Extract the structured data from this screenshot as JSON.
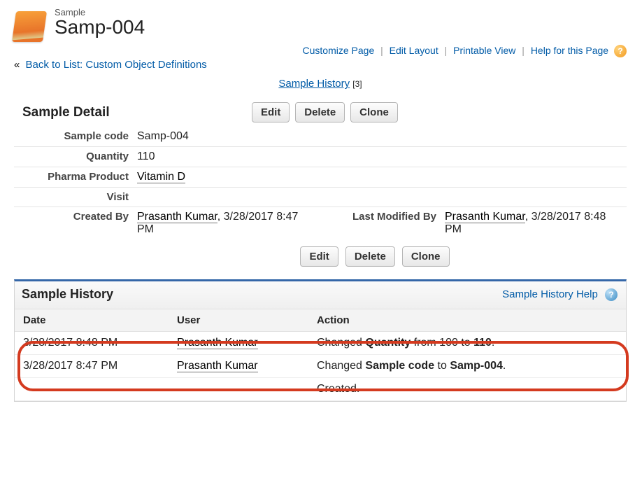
{
  "header": {
    "objectLabel": "Sample",
    "recordName": "Samp-004"
  },
  "actionLinks": {
    "customizePage": "Customize Page",
    "editLayout": "Edit Layout",
    "printableView": "Printable View",
    "helpForPage": "Help for this Page"
  },
  "backLink": {
    "prefix": "«",
    "text": "Back to List: Custom Object Definitions"
  },
  "miniList": {
    "label": "Sample History",
    "count": "[3]"
  },
  "detail": {
    "title": "Sample Detail",
    "buttons": {
      "edit": "Edit",
      "delete": "Delete",
      "clone": "Clone"
    },
    "labels": {
      "sampleCode": "Sample code",
      "quantity": "Quantity",
      "pharmaProduct": "Pharma Product",
      "visit": "Visit",
      "createdBy": "Created By",
      "lastModifiedBy": "Last Modified By"
    },
    "values": {
      "sampleCode": "Samp-004",
      "quantity": "110",
      "pharmaProduct": "Vitamin D",
      "visit": "",
      "createdByUser": "Prasanth Kumar",
      "createdByDate": ", 3/28/2017 8:47 PM",
      "lastModifiedByUser": "Prasanth Kumar",
      "lastModifiedByDate": ", 3/28/2017 8:48 PM"
    }
  },
  "history": {
    "title": "Sample History",
    "helpLabel": "Sample History Help",
    "columns": {
      "date": "Date",
      "user": "User",
      "action": "Action"
    },
    "rows": [
      {
        "date": "3/28/2017 8:48 PM",
        "user": "Prasanth Kumar",
        "action_pre": "Changed ",
        "action_field": "Quantity",
        "action_mid": " from 100 to ",
        "action_val": "110",
        "action_post": "."
      },
      {
        "date": "3/28/2017 8:47 PM",
        "user": "Prasanth Kumar",
        "action_pre": "Changed ",
        "action_field": "Sample code",
        "action_mid": " to ",
        "action_val": "Samp-004",
        "action_post": "."
      },
      {
        "date": "",
        "user": "",
        "action_pre": "Created.",
        "action_field": "",
        "action_mid": "",
        "action_val": "",
        "action_post": ""
      }
    ]
  }
}
